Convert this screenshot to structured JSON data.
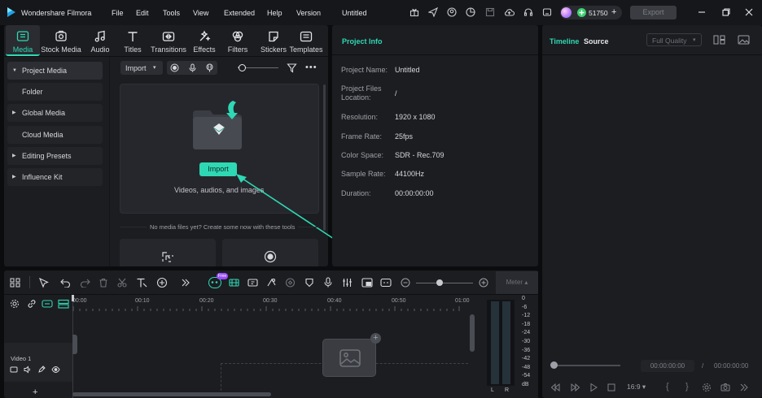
{
  "app": {
    "name": "Wondershare Filmora",
    "project_title": "Untitled"
  },
  "menu": [
    "File",
    "Edit",
    "Tools",
    "View",
    "Extended",
    "Help",
    "Version"
  ],
  "credits": "51750",
  "export_label": "Export",
  "tabs": [
    {
      "label": "Media",
      "icon": "media-icon",
      "active": true
    },
    {
      "label": "Stock Media",
      "icon": "stock-media-icon"
    },
    {
      "label": "Audio",
      "icon": "audio-icon"
    },
    {
      "label": "Titles",
      "icon": "titles-icon"
    },
    {
      "label": "Transitions",
      "icon": "transitions-icon"
    },
    {
      "label": "Effects",
      "icon": "effects-icon"
    },
    {
      "label": "Filters",
      "icon": "filters-icon"
    },
    {
      "label": "Stickers",
      "icon": "stickers-icon"
    },
    {
      "label": "Templates",
      "icon": "templates-icon"
    }
  ],
  "sidebar": [
    {
      "label": "Project Media",
      "caret": true,
      "active": true
    },
    {
      "label": "Folder",
      "caret": false
    },
    {
      "label": "Global Media",
      "caret": true
    },
    {
      "label": "Cloud Media",
      "caret": false
    },
    {
      "label": "Editing Presets",
      "caret": true
    },
    {
      "label": "Influence Kit",
      "caret": true
    }
  ],
  "media": {
    "import_dropdown": "Import",
    "import_button": "Import",
    "drop_hint": "Videos, audios, and images",
    "empty_hint": "No media files yet? Create some now with these tools"
  },
  "project_info": {
    "title": "Project Info",
    "rows": [
      {
        "label": "Project Name:",
        "value": "Untitled"
      },
      {
        "label": "Project Files Location:",
        "value": "/"
      },
      {
        "label": "Resolution:",
        "value": "1920 x 1080"
      },
      {
        "label": "Frame Rate:",
        "value": "25fps"
      },
      {
        "label": "Color Space:",
        "value": "SDR - Rec.709"
      },
      {
        "label": "Sample Rate:",
        "value": "44100Hz"
      },
      {
        "label": "Duration:",
        "value": "00:00:00:00"
      }
    ]
  },
  "preview": {
    "tab_timeline": "Timeline",
    "tab_source": "Source",
    "quality": "Full Quality",
    "current_time": "00:00:00:00",
    "separator": "/",
    "total_time": "00:00:00:00",
    "ratio": "16:9"
  },
  "toolbar": {
    "meter": "Meter",
    "new_badge": "Free"
  },
  "timeline": {
    "ticks": [
      "00:00",
      "00:10",
      "00:20",
      "00:30",
      "00:40",
      "00:50",
      "01:00"
    ],
    "track_label": "Video 1"
  },
  "meter": {
    "scale": [
      "0",
      "-6",
      "-12",
      "-18",
      "-24",
      "-30",
      "-36",
      "-42",
      "-48",
      "-54",
      "dB"
    ],
    "channels": [
      "L",
      "R"
    ]
  },
  "colors": {
    "accent": "#2fd8b4",
    "panel": "#1c1d21",
    "background": "#0b0c0e"
  }
}
